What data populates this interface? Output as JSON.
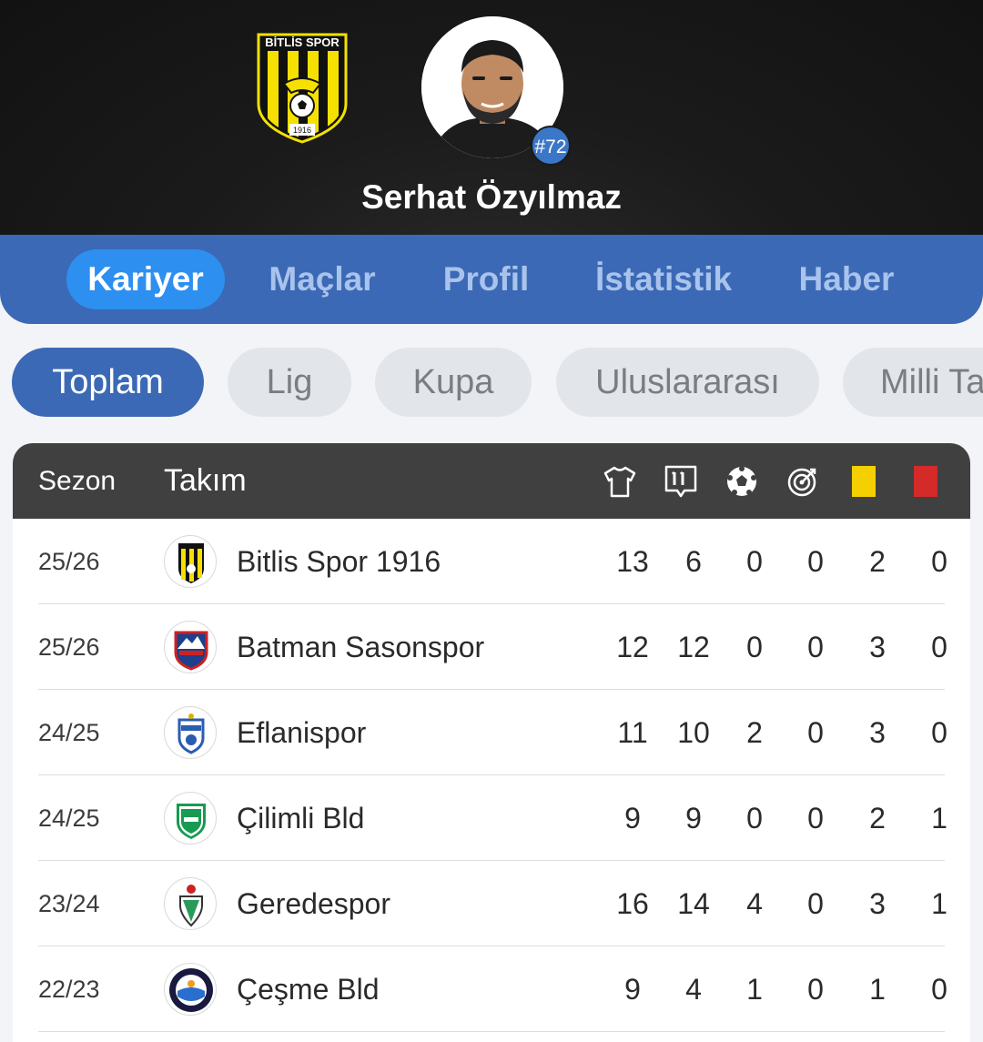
{
  "player": {
    "name": "Serhat Özyılmaz",
    "number": "#72",
    "club_logo_text": "BİTLİS SPOR",
    "club_logo_year": "1916"
  },
  "tabs": [
    {
      "label": "Kariyer",
      "active": true
    },
    {
      "label": "Maçlar",
      "active": false
    },
    {
      "label": "Profil",
      "active": false
    },
    {
      "label": "İstatistik",
      "active": false
    },
    {
      "label": "Haber",
      "active": false
    }
  ],
  "filters": [
    {
      "label": "Toplam",
      "active": true
    },
    {
      "label": "Lig",
      "active": false
    },
    {
      "label": "Kupa",
      "active": false
    },
    {
      "label": "Uluslararası",
      "active": false
    },
    {
      "label": "Milli Takım",
      "active": false
    }
  ],
  "table": {
    "headers": {
      "season": "Sezon",
      "team": "Takım",
      "icons": [
        "jersey-icon",
        "lineup-icon",
        "ball-icon",
        "target-icon",
        "yellow-card-icon",
        "red-card-icon"
      ]
    },
    "colors": {
      "yellow_card": "#f5d000",
      "red_card": "#d42a2a",
      "header_bg": "#404040"
    },
    "rows": [
      {
        "season": "25/26",
        "team": "Bitlis Spor 1916",
        "logo": "bitlis-spor-logo",
        "stats": [
          "13",
          "6",
          "0",
          "0",
          "2",
          "0"
        ]
      },
      {
        "season": "25/26",
        "team": "Batman Sasonspor",
        "logo": "batman-sasonspor-logo",
        "stats": [
          "12",
          "12",
          "0",
          "0",
          "3",
          "0"
        ]
      },
      {
        "season": "24/25",
        "team": "Eflanispor",
        "logo": "eflanispor-logo",
        "stats": [
          "11",
          "10",
          "2",
          "0",
          "3",
          "0"
        ]
      },
      {
        "season": "24/25",
        "team": "Çilimli Bld",
        "logo": "cilimli-bld-logo",
        "stats": [
          "9",
          "9",
          "0",
          "0",
          "2",
          "1"
        ]
      },
      {
        "season": "23/24",
        "team": "Geredespor",
        "logo": "geredespor-logo",
        "stats": [
          "16",
          "14",
          "4",
          "0",
          "3",
          "1"
        ]
      },
      {
        "season": "22/23",
        "team": "Çeşme Bld",
        "logo": "cesme-bld-logo",
        "stats": [
          "9",
          "4",
          "1",
          "0",
          "1",
          "0"
        ]
      }
    ]
  }
}
